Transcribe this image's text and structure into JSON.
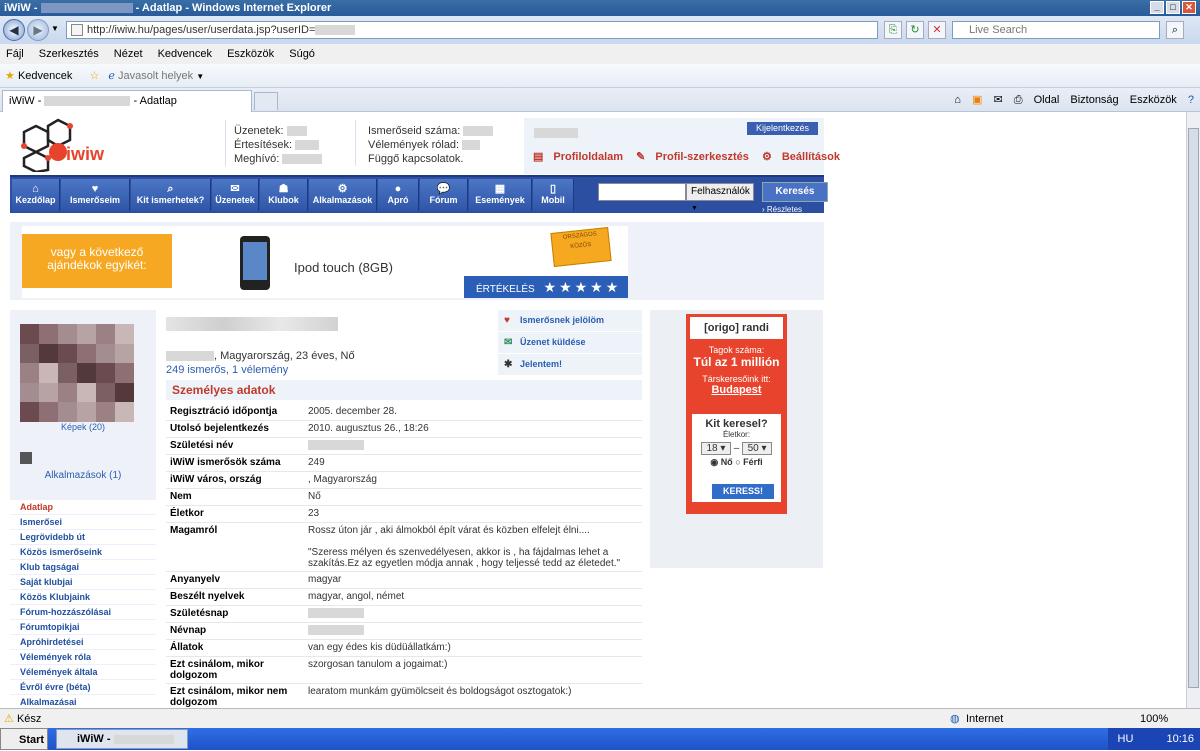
{
  "window": {
    "title_prefix": "iWiW - ",
    "title_suffix": " - Adatlap - Windows Internet Explorer"
  },
  "browser": {
    "url": "http://iwiw.hu/pages/user/userdata.jsp?userID=",
    "search_placeholder": "Live Search",
    "menu": [
      "Fájl",
      "Szerkesztés",
      "Nézet",
      "Kedvencek",
      "Eszközök",
      "Súgó"
    ],
    "favorites_label": "Kedvencek",
    "suggested_label": "Javasolt helyek",
    "tab_prefix": "iWiW - ",
    "tab_suffix": " - Adatlap",
    "cmd": {
      "page": "Oldal",
      "security": "Biztonság",
      "tools": "Eszközök"
    },
    "status_ready": "Kész",
    "status_zone": "Internet",
    "zoom": "100%"
  },
  "taskbar": {
    "start": "Start",
    "item": "iWiW - ",
    "lang": "HU",
    "clock": "10:16"
  },
  "header": {
    "messages_label": "Üzenetek:",
    "notifications_label": "Értesítések:",
    "invites_label": "Meghívó:",
    "acquaintances_label": "Ismerőseid száma:",
    "opinions_label": "Vélemények rólad:",
    "pending_label": "Függő kapcsolatok.",
    "logout": "Kijelentkezés",
    "profile": "Profiloldalam",
    "profile_edit": "Profil-szerkesztés",
    "settings": "Beállítások"
  },
  "nav": {
    "items": [
      "Kezdőlap",
      "Ismerőseim",
      "Kit ismerhetek?",
      "Üzenetek",
      "Klubok",
      "Alkalmazások",
      "Apró",
      "Fórum",
      "Események",
      "Mobil"
    ],
    "search_select": "Felhasználók",
    "search_button": "Keresés",
    "advanced": "› Részletes keresés"
  },
  "banner": {
    "left_text": "vagy a következő ajándékok egyikét:",
    "product": "Ipod touch (8GB)",
    "ticket_text": "ORSZÁGOS KÖZÖS",
    "rate_label": "ÉRTÉKELÉS",
    "stars": 5
  },
  "left": {
    "photos": "Képek (20)",
    "apps": "Alkalmazások (1)",
    "menu": [
      "Adatlap",
      "Ismerősei",
      "Legrövidebb út",
      "Közös ismerőseink",
      "Klub tagságai",
      "Saját klubjai",
      "Közös Klubjaink",
      "Fórum-hozzászólásai",
      "Fórumtopikjai",
      "Apróhirdetései",
      "Vélemények róla",
      "Vélemények általa",
      "Évről évre (béta)",
      "Alkalmazásai"
    ]
  },
  "profile": {
    "location_line": ", Magyarország, 23 éves, Nő",
    "stats_line": "249 ismerős, 1 vélemény",
    "actions": [
      "Ismerősnek jelölöm",
      "Üzenet küldése",
      "Jelentem!"
    ],
    "section_title": "Személyes adatok",
    "fields": [
      {
        "k": "Regisztráció időpontja",
        "v": "2005. december 28."
      },
      {
        "k": "Utolsó bejelentkezés",
        "v": "2010. augusztus 26., 18:26"
      },
      {
        "k": "Születési név",
        "v": ""
      },
      {
        "k": "iWiW ismerősök száma",
        "v": "249"
      },
      {
        "k": "iWiW város, ország",
        "v": ", Magyarország"
      },
      {
        "k": "Nem",
        "v": "Nő"
      },
      {
        "k": "Életkor",
        "v": "23"
      },
      {
        "k": "Magamról",
        "v": "Rossz úton jár , aki álmokból épít várat és közben elfelejt élni....\n\n\"Szeress mélyen és szenvedélyesen, akkor is , ha fájdalmas lehet a szakítás.Ez az egyetlen módja annak , hogy teljessé tedd az életedet.\""
      },
      {
        "k": "Anyanyelv",
        "v": "magyar"
      },
      {
        "k": "Beszélt nyelvek",
        "v": "magyar, angol, német"
      },
      {
        "k": "Születésnap",
        "v": ""
      },
      {
        "k": "Névnap",
        "v": ""
      },
      {
        "k": "Állatok",
        "v": "van egy édes kis düdüállatkám:)"
      },
      {
        "k": "Ezt csinálom, mikor dolgozom",
        "v": "szorgosan tanulom a jogaimat:)"
      },
      {
        "k": "Ezt csinálom, mikor nem dolgozom",
        "v": "learatom munkám gyümölcseit és boldogságot osztogatok:)"
      }
    ]
  },
  "ad": {
    "logo": "[origo] randi",
    "members_label": "Tagok száma:",
    "members_value": "Túl az 1 millión",
    "partner_label": "Társkeresőink itt:",
    "city": "Budapest",
    "question": "Kit keresel?",
    "age_label": "Életkor:",
    "age_from": "18",
    "age_to": "50",
    "female": "Nő",
    "male": "Férfi",
    "button": "KERESS!"
  },
  "colors": {
    "accent": "#2c4fa1",
    "link": "#2a5db0",
    "red": "#c0392b",
    "ad": "#e8432c",
    "banner_orange": "#f7a823"
  }
}
